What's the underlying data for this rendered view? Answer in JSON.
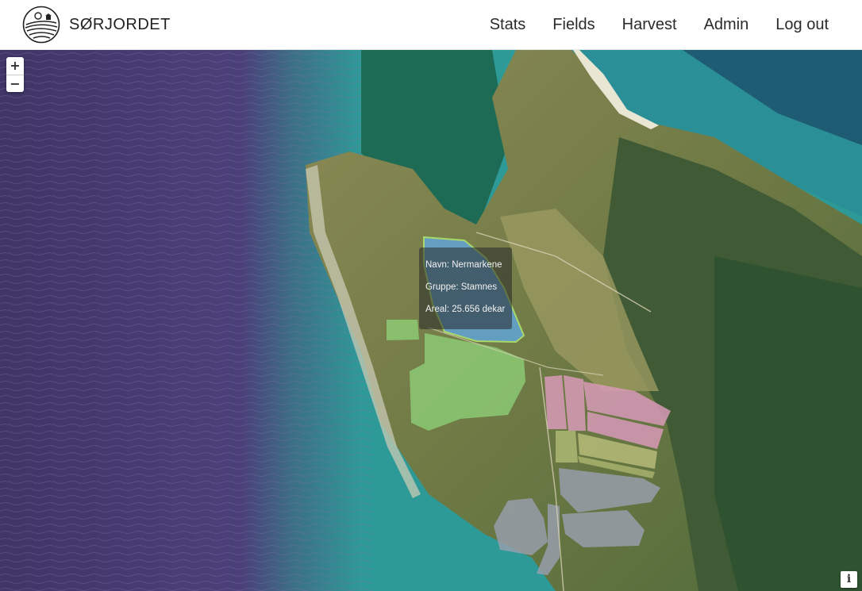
{
  "brand": {
    "name": "SØRJORDET",
    "logo_icon": "farm-field-sun-icon"
  },
  "nav": {
    "items": [
      {
        "label": "Stats"
      },
      {
        "label": "Fields"
      },
      {
        "label": "Harvest"
      },
      {
        "label": "Admin"
      },
      {
        "label": "Log out"
      }
    ]
  },
  "map": {
    "zoom_in_label": "+",
    "zoom_out_label": "−",
    "attribution_label": "i",
    "tooltip": {
      "name_line": "Navn: Nermarkene",
      "group_line": "Gruppe: Stamnes",
      "area_line": "Areal: 25.656 dekar"
    },
    "colors": {
      "selected_field": "#5ea9e8",
      "green_fields": "#8fd47a",
      "pink_fields": "#d79ab7",
      "grey_fields": "#9aa0b0",
      "sea_deep": "#4a3f74",
      "sea_shallow": "#2b9a95"
    }
  }
}
